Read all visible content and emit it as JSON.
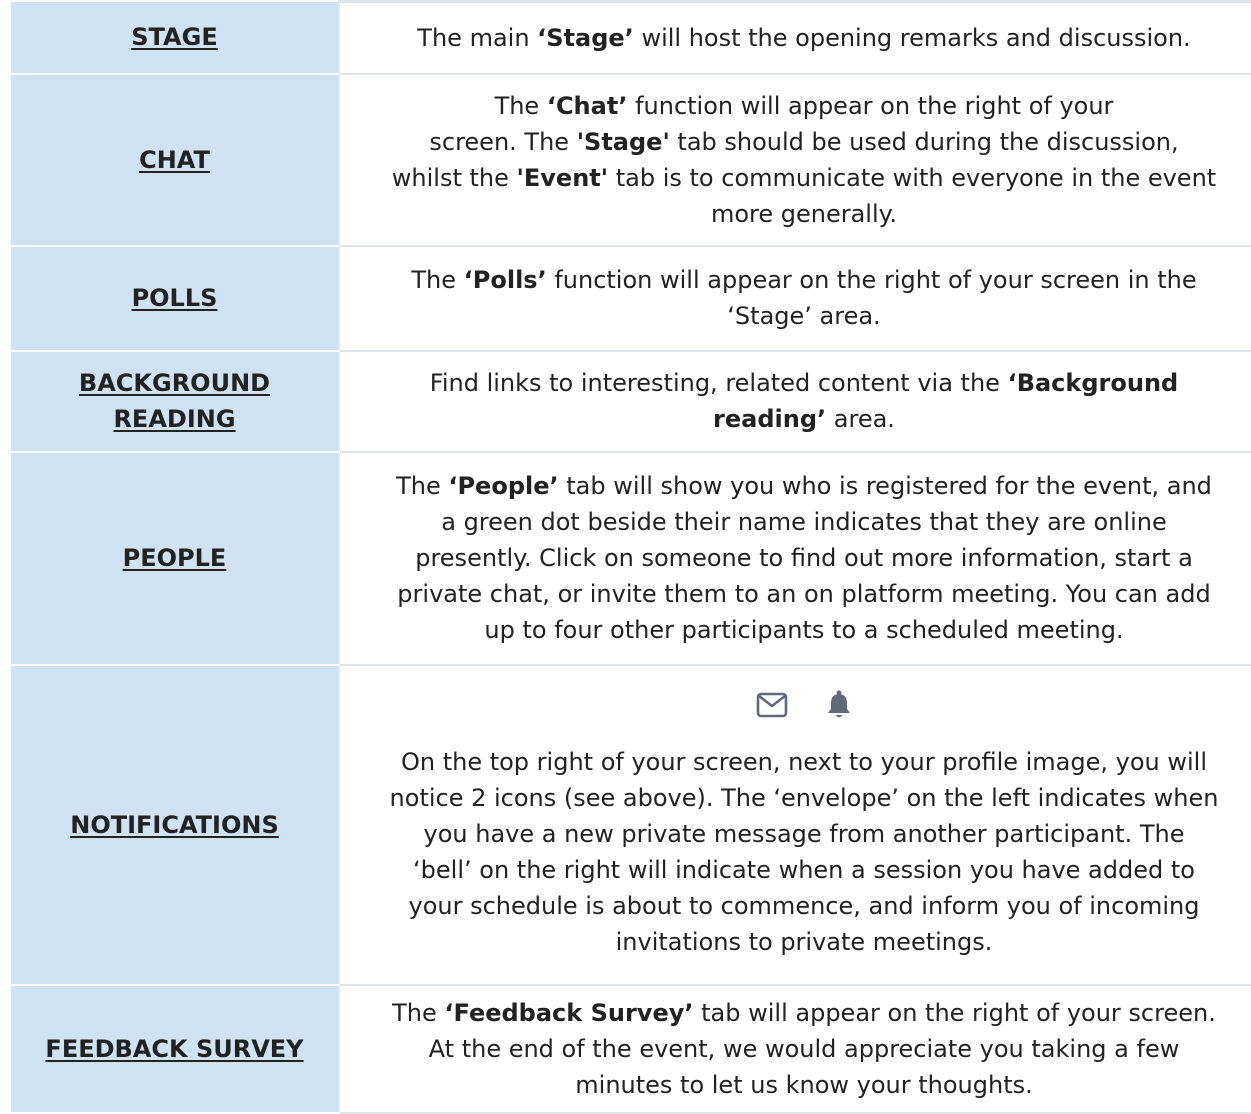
{
  "rows": [
    {
      "label": "STAGE",
      "desc": {
        "a": "The main ",
        "b1": "‘Stage’",
        "c": " will host the opening remarks and discussion."
      }
    },
    {
      "label": "CHAT",
      "desc": {
        "a": "The ",
        "b1": "‘Chat’",
        "c": " function will appear on the right of your",
        "d": "screen. The ",
        "b2": "'Stage'",
        "e": " tab should be used during the discussion,",
        "f": "whilst the ",
        "b3": "'Event'",
        "g": " tab is to communicate with everyone in the event",
        "h": "more generally."
      }
    },
    {
      "label": "POLLS",
      "desc": {
        "a": "The ",
        "b1": "‘Polls’",
        "c": " function will appear on the right of your screen in the",
        "d": "‘Stage’ area."
      }
    },
    {
      "label_line1": "BACKGROUND",
      "label_line2": "READING",
      "desc": {
        "a": "Find links to interesting, related content via the ",
        "b1": "‘Background",
        "b2": "reading’",
        "c": " area."
      }
    },
    {
      "label": "PEOPLE",
      "desc": {
        "a": "The ",
        "b1": "‘People’",
        "c": " tab will show you who is registered for the event, and",
        "d": "a green dot beside their name indicates that they are online",
        "e": "presently. Click on someone to find out more information, start a",
        "f": "private chat, or invite them to an on platform meeting. You can add",
        "g": "up to four other participants to a scheduled meeting."
      }
    },
    {
      "label": "NOTIFICATIONS",
      "icons": [
        "envelope-icon",
        "bell-icon"
      ],
      "desc": {
        "a": "On the top right of your screen, next to your profile image, you will",
        "b": "notice 2 icons (see above). The ‘envelope’ on the left indicates when",
        "c": "you have a new private message from another participant. The",
        "d": "‘bell’ on the right will indicate when a session you have added to",
        "e": "your schedule is about to commence, and inform you of incoming",
        "f": "invitations to private meetings."
      }
    },
    {
      "label": "FEEDBACK SURVEY",
      "desc": {
        "a": "The ",
        "b1": "‘Feedback Survey’",
        "c": " tab will appear on the right of your screen.",
        "d": "At the end of the event, we would appreciate you taking a few",
        "e": "minutes to let us know your thoughts."
      }
    }
  ],
  "colors": {
    "label_background": "#cfe2f3",
    "text": "#222222",
    "icon": "#5f6b7a"
  }
}
